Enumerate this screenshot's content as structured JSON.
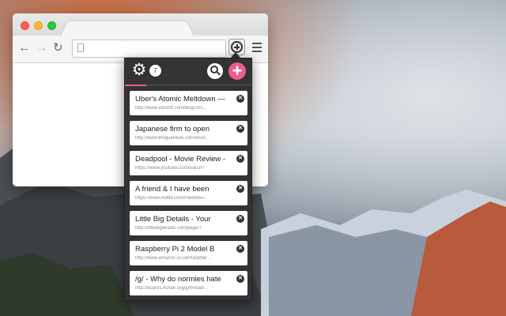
{
  "toolbar": {
    "back_icon": "arrow-left-icon",
    "forward_icon": "arrow-right-icon",
    "reload_icon": "reload-icon",
    "address": ""
  },
  "popup": {
    "count": "7",
    "accent_color": "#ef5c8c",
    "items": [
      {
        "title": "Uber's Atomic Meltdown —",
        "url": "http://www.elschiff.com/blog/201..."
      },
      {
        "title": "Japanese firm to open",
        "url": "http://www.theguardian.com/envir..."
      },
      {
        "title": "Deadpool - Movie Review -",
        "url": "https://www.youtube.com/watch?"
      },
      {
        "title": "A friend & I have been",
        "url": "https://www.reddit.com/r/webdev..."
      },
      {
        "title": "Little Big Details - Your",
        "url": "http://littlebigdetails.com/page/7"
      },
      {
        "title": "Raspberry Pi 2 Model B",
        "url": "http://www.amazon.co.uk/Raspber..."
      },
      {
        "title": "/g/ - Why do normies hate",
        "url": "http://boards.4chan.org/g/thread/..."
      }
    ]
  }
}
